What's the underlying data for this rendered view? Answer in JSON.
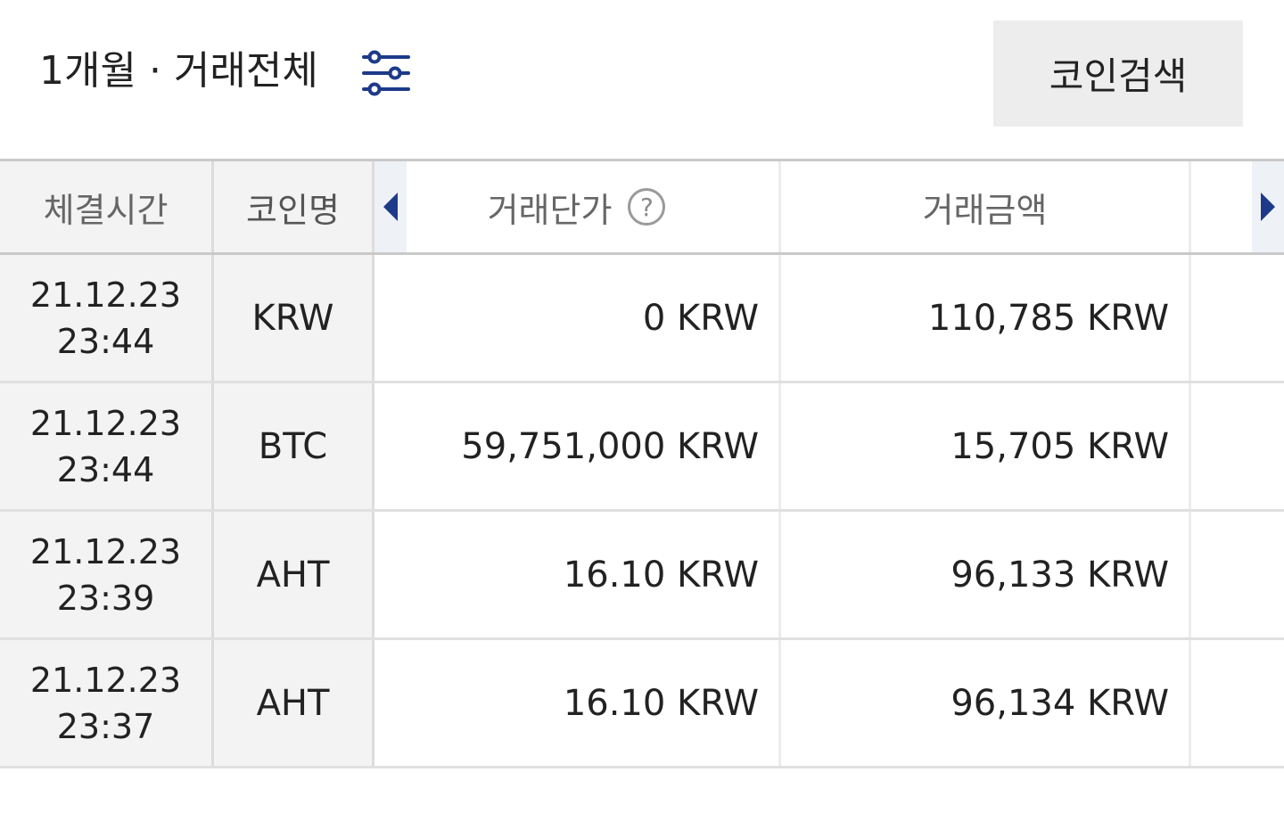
{
  "header": {
    "filter_label": "1개월 · 거래전체",
    "filter_icon": "sliders-icon",
    "search_button_label": "코인검색"
  },
  "table": {
    "columns": {
      "time": "체결시간",
      "coin": "코인명",
      "price": "거래단가",
      "amount": "거래금액"
    },
    "help_icon_label": "?",
    "rows": [
      {
        "date": "21.12.23",
        "time": "23:44",
        "coin": "KRW",
        "price": "0 KRW",
        "amount": "110,785 KRW"
      },
      {
        "date": "21.12.23",
        "time": "23:44",
        "coin": "BTC",
        "price": "59,751,000 KRW",
        "amount": "15,705 KRW"
      },
      {
        "date": "21.12.23",
        "time": "23:39",
        "coin": "AHT",
        "price": "16.10 KRW",
        "amount": "96,133 KRW"
      },
      {
        "date": "21.12.23",
        "time": "23:37",
        "coin": "AHT",
        "price": "16.10 KRW",
        "amount": "96,134 KRW"
      }
    ]
  },
  "colors": {
    "accent": "#1d3a8a",
    "header_bg": "#f3f3f3",
    "button_bg": "#ededed"
  }
}
